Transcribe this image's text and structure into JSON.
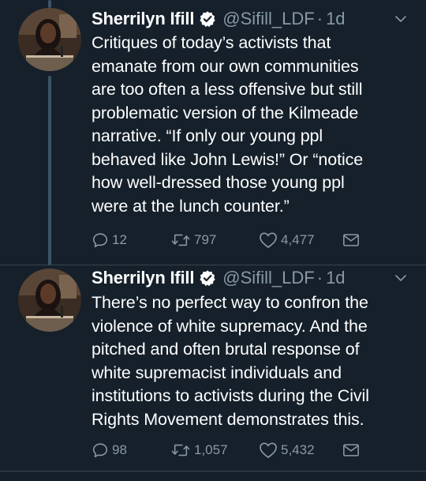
{
  "colors": {
    "background": "#15202b",
    "secondary_text": "#8899a6",
    "divider": "#38444d",
    "thread_line": "#3d5466"
  },
  "tweets": [
    {
      "author_name": "Sherrilyn Ifill",
      "verified_icon": "verified-badge-icon",
      "handle": "@Sifill_LDF",
      "separator": "·",
      "time": "1d",
      "text": "Critiques of today’s activists that\nemanate from our own communities\nare too often a less offensive but still\nproblematic version of the Kilmeade\nnarrative. “If only our young ppl\nbehaved like John Lewis!” Or “notice\nhow well-dressed those young ppl\nwere at the lunch counter.”",
      "replies": "12",
      "retweets": "797",
      "likes": "4,477"
    },
    {
      "author_name": "Sherrilyn Ifill",
      "verified_icon": "verified-badge-icon",
      "handle": "@Sifill_LDF",
      "separator": "·",
      "time": "1d",
      "text": "There’s no perfect way to confron the\nviolence of white supremacy. And the\npitched and often brutal response of\nwhite supremacist individuals and\ninstitutions to activists during the Civil\nRights Movement demonstrates this.",
      "replies": "98",
      "retweets": "1,057",
      "likes": "5,432"
    }
  ]
}
